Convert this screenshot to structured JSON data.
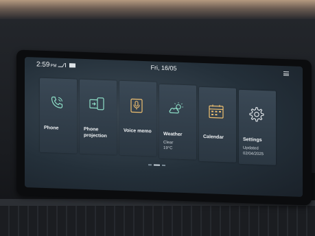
{
  "status": {
    "time": "2:59",
    "time_suffix": "PM",
    "date": "Fri, 16/05"
  },
  "tiles": [
    {
      "label": "Phone",
      "icon": "phone-icon"
    },
    {
      "label": "Phone projection",
      "icon": "phone-projection-icon"
    },
    {
      "label": "Voice memo",
      "icon": "voice-memo-icon"
    },
    {
      "label": "Weather",
      "icon": "weather-cloud-sun-icon",
      "sub1": "Clear",
      "sub2": "19°C"
    },
    {
      "label": "Calendar",
      "icon": "calendar-icon"
    },
    {
      "label": "Settings",
      "icon": "gear-icon",
      "sub1": "Updated",
      "sub2": "02/04/2025"
    }
  ],
  "colors": {
    "icon_accent": "#8fe0c8",
    "tile_bg": "#34424f"
  }
}
